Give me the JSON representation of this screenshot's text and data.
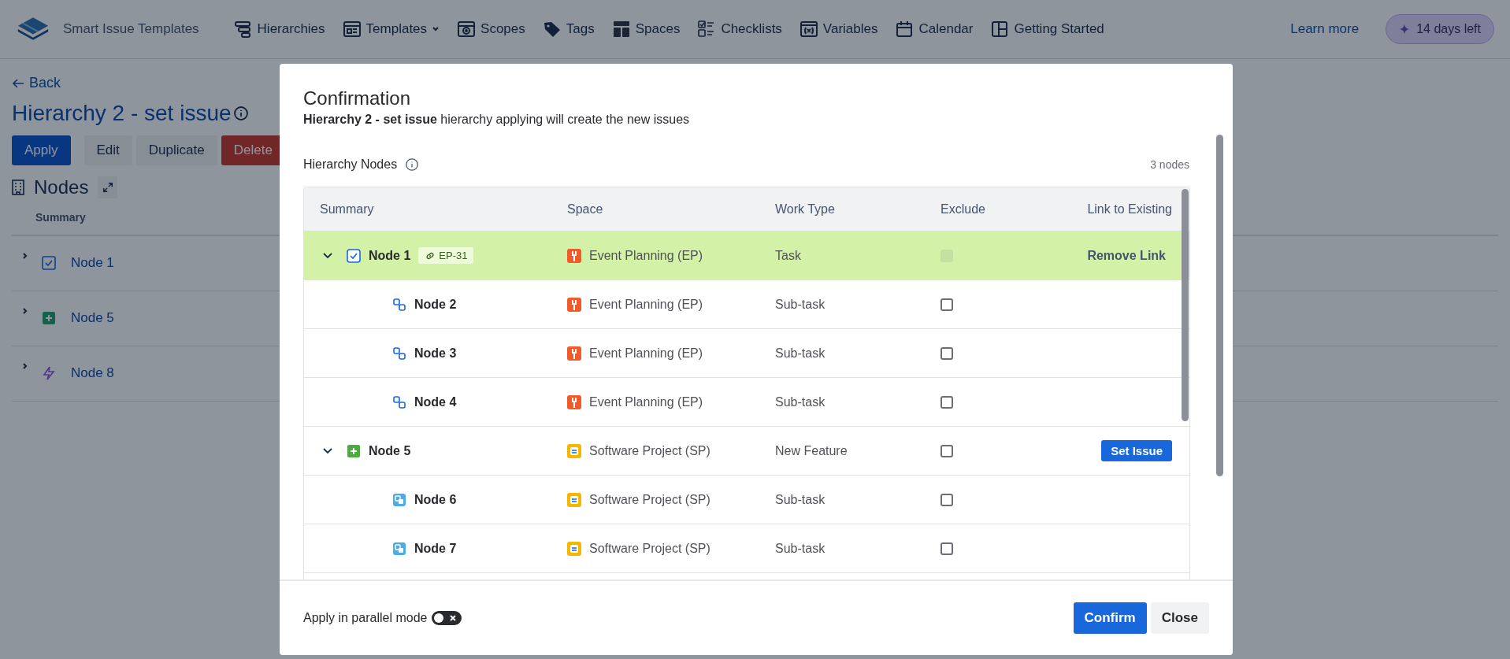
{
  "app": {
    "name": "Smart Issue Templates"
  },
  "nav": [
    {
      "label": "Hierarchies",
      "kind": "hierarchy",
      "dropdown": false
    },
    {
      "label": "Templates",
      "kind": "templates",
      "dropdown": true
    },
    {
      "label": "Scopes",
      "kind": "scopes",
      "dropdown": false
    },
    {
      "label": "Tags",
      "kind": "tags",
      "dropdown": false
    },
    {
      "label": "Spaces",
      "kind": "spaces",
      "dropdown": false
    },
    {
      "label": "Checklists",
      "kind": "checklists",
      "dropdown": false
    },
    {
      "label": "Variables",
      "kind": "variables",
      "dropdown": false
    },
    {
      "label": "Calendar",
      "kind": "calendar",
      "dropdown": false
    },
    {
      "label": "Getting Started",
      "kind": "guide",
      "dropdown": false
    }
  ],
  "learn_more": "Learn more",
  "trial_badge": "14 days left",
  "page": {
    "back": "Back",
    "title": "Hierarchy 2 - set issue",
    "actions": [
      {
        "label": "Apply",
        "kind": "primary"
      },
      {
        "label": "Edit",
        "kind": "default"
      },
      {
        "label": "Duplicate",
        "kind": "default"
      },
      {
        "label": "Delete",
        "kind": "danger"
      }
    ],
    "nodes_heading": "Nodes",
    "column": "Summary",
    "nodes": [
      {
        "label": "Node 1",
        "kind": "task",
        "expanded": false
      },
      {
        "label": "Node 5",
        "kind": "feature",
        "expanded": false
      },
      {
        "label": "Node 8",
        "kind": "epic",
        "expanded": false
      }
    ]
  },
  "dialog": {
    "title": "Confirmation",
    "subtitle": "**Hierarchy 2 - set issue** hierarchy applying will create the new issues",
    "section_label": "Hierarchy Nodes",
    "count": "3 nodes",
    "columns": [
      "Summary",
      "Space",
      "Work Type",
      "Exclude",
      "Link to Existing"
    ],
    "rows": [
      {
        "summary": "Node 1",
        "kind": "task",
        "expanded": true,
        "highlighted": true,
        "link_key": "EP-31",
        "space": {
          "name": "Event Planning (EP)",
          "kind": "event"
        },
        "work_type": "Task",
        "exclude": {
          "checked": false,
          "disabled": true
        },
        "action": {
          "kind": "text",
          "label": "Remove Link"
        },
        "children": [
          {
            "summary": "Node 2",
            "kind": "subtask",
            "highlighted": false,
            "space": {
              "name": "Event Planning (EP)",
              "kind": "event"
            },
            "work_type": "Sub-task",
            "exclude": {
              "checked": false,
              "disabled": false
            }
          },
          {
            "summary": "Node 3",
            "kind": "subtask",
            "highlighted": false,
            "space": {
              "name": "Event Planning (EP)",
              "kind": "event"
            },
            "work_type": "Sub-task",
            "exclude": {
              "checked": false,
              "disabled": false
            }
          },
          {
            "summary": "Node 4",
            "kind": "subtask",
            "highlighted": false,
            "space": {
              "name": "Event Planning (EP)",
              "kind": "event"
            },
            "work_type": "Sub-task",
            "exclude": {
              "checked": false,
              "disabled": false
            }
          }
        ]
      },
      {
        "summary": "Node 5",
        "kind": "feature",
        "expanded": true,
        "highlighted": false,
        "space": {
          "name": "Software Project (SP)",
          "kind": "software"
        },
        "work_type": "New Feature",
        "exclude": {
          "checked": false,
          "disabled": false
        },
        "action": {
          "kind": "button",
          "label": "Set Issue"
        },
        "children": [
          {
            "summary": "Node 6",
            "kind": "subtask-filled",
            "highlighted": false,
            "space": {
              "name": "Software Project (SP)",
              "kind": "software"
            },
            "work_type": "Sub-task",
            "exclude": {
              "checked": false,
              "disabled": false
            }
          },
          {
            "summary": "Node 7",
            "kind": "subtask-filled",
            "highlighted": false,
            "space": {
              "name": "Software Project (SP)",
              "kind": "software"
            },
            "work_type": "Sub-task",
            "exclude": {
              "checked": false,
              "disabled": false
            }
          }
        ]
      }
    ],
    "parallel": {
      "label": "Apply in parallel mode",
      "on": false
    },
    "buttons": [
      {
        "label": "Confirm",
        "kind": "primary"
      },
      {
        "label": "Close",
        "kind": "default"
      }
    ]
  }
}
